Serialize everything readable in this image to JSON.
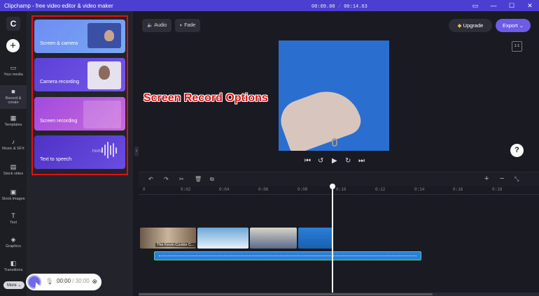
{
  "window": {
    "title": "Clipchamp - free video editor & video maker"
  },
  "rail": {
    "logo": "C",
    "add": "+",
    "items": [
      {
        "label": "Your media",
        "icon": "folder-icon"
      },
      {
        "label": "Record & create",
        "icon": "camera-icon"
      },
      {
        "label": "Templates",
        "icon": "grid-icon"
      },
      {
        "label": "Music & SFX",
        "icon": "music-icon"
      },
      {
        "label": "Stock video",
        "icon": "film-icon"
      },
      {
        "label": "Stock images",
        "icon": "image-icon"
      },
      {
        "label": "Text",
        "icon": "text-icon"
      },
      {
        "label": "Graphics",
        "icon": "shapes-icon"
      },
      {
        "label": "Transitions",
        "icon": "transition-icon"
      }
    ],
    "more": "More"
  },
  "options": [
    {
      "label": "Screen & camera"
    },
    {
      "label": "Camera recording"
    },
    {
      "label": "Screen recording"
    },
    {
      "label": "Text to speech",
      "hello": "Hello"
    }
  ],
  "recorder": {
    "current": "00:00",
    "total": "30:00"
  },
  "toolbar": {
    "audio": "Audio",
    "fade": "Fade",
    "upgrade": "Upgrade",
    "export": "Export",
    "ratio": "1:1"
  },
  "overlay_text": "Screen Record Options",
  "timeline": {
    "time_current": "00:09.08",
    "time_total": "00:14.63",
    "ticks": [
      "0",
      "0:02",
      "0:04",
      "0:06",
      "0:08",
      "0:10",
      "0:12",
      "0:14",
      "0:16",
      "0:18"
    ],
    "clip_label": "The Kevin Cookie C..."
  }
}
